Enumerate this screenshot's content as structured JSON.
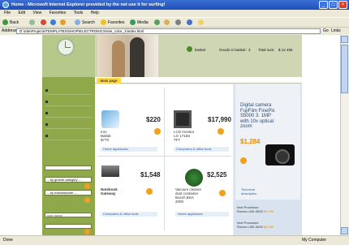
{
  "window": {
    "title": "Home - Microsoft Internet Explorer provided by the net use it for surfing!"
  },
  "menu": [
    "File",
    "Edit",
    "View",
    "Favorites",
    "Tools",
    "Help"
  ],
  "toolbar": {
    "back": "Back",
    "search": "Search",
    "favorites": "Favorites",
    "media": "Media"
  },
  "address": {
    "label": "Address",
    "value": "D:\\Site\\Projects\\TEMPLATES\\SHOP\\ELECTRONICS\\site_color_1\\index.html",
    "go": "Go",
    "links": "Links"
  },
  "site": {
    "header": {
      "basket_label": "basket",
      "goods_label": "Goods in basket:",
      "goods_count": "3",
      "total_label": "Total sum:",
      "total_value": "$ 12 456"
    },
    "nav_tab": "Main page",
    "sidebar": {
      "category_select": "-- by growth category --",
      "manufacturer_select": "-- by manufacturer --",
      "username_placeholder": "user name"
    },
    "products": [
      {
        "name": "Iron\nBallab\n$770",
        "price": "$220",
        "category": "Home appliances"
      },
      {
        "name": "LCD monitor\nLG 1715S\nTFT",
        "price": "$17,990",
        "category": "Computers & office tools"
      },
      {
        "name": "Notebook\nGateway",
        "price": "$1,548",
        "category": "Computers & office tools"
      },
      {
        "name": "Vacuum cleaner\ndust container\nBosch BSA\n2000",
        "price": "$2,525",
        "category": "Home appliances"
      }
    ],
    "featured": {
      "title": "Digital camera\nFujiFilm FinePix\nS5000 3. 1MP\nwith 10x optical\nzoom",
      "price": "$1,284",
      "tech_link": "Technical\ndescription",
      "processors": [
        {
          "label": "Intel Processor",
          "name": "Romeo i-BK-9000",
          "price": "$9,999"
        },
        {
          "label": "Intel Processor",
          "name": "Romeo i-BK-9000",
          "price": "$9,999"
        }
      ]
    }
  },
  "status": {
    "text": "Done",
    "zone": "My Computer"
  },
  "colors": {
    "sidebar": "#8fa94a",
    "accent": "#f3a11b",
    "xp_title": "#2a5ac8"
  }
}
